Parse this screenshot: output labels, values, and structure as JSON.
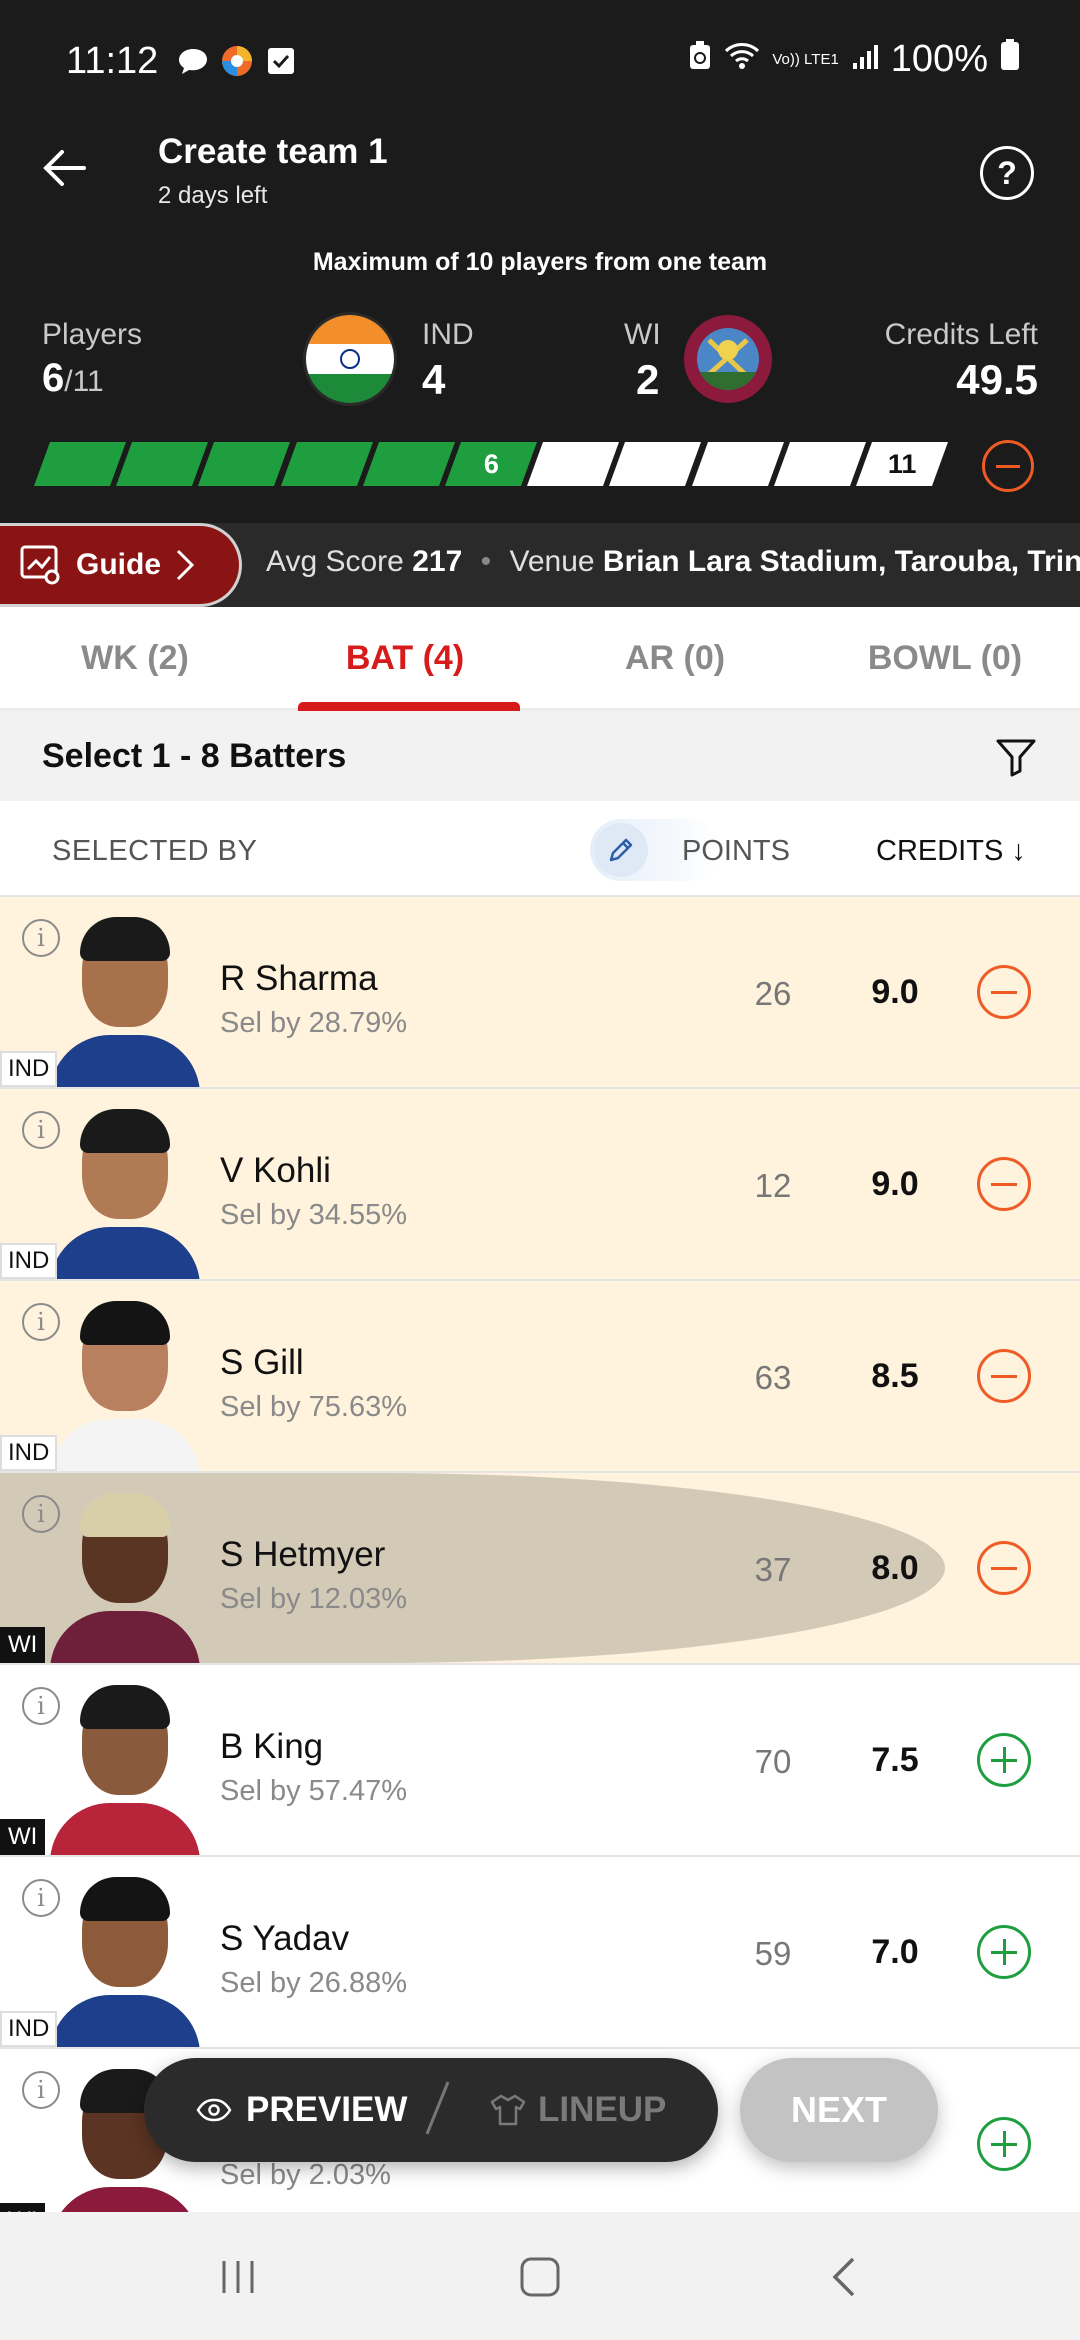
{
  "status_bar": {
    "time": "11:12",
    "icons_left": [
      "chat-icon",
      "browser-icon",
      "checkbox-icon"
    ],
    "icons_right": [
      "battery-saver-icon",
      "wifi-icon",
      "volte-icon",
      "signal-icon"
    ],
    "volte": "Vo)) LTE1",
    "battery": "100%"
  },
  "header": {
    "title": "Create team 1",
    "subtitle": "2 days left",
    "note": "Maximum of 10 players from one team"
  },
  "summary": {
    "players_label": "Players",
    "players_selected": "6",
    "players_total": "/11",
    "team1": {
      "name": "IND",
      "count": "4"
    },
    "team2": {
      "name": "WI",
      "count": "2"
    },
    "credits_label": "Credits Left",
    "credits_value": "49.5"
  },
  "progress": {
    "filled": 6,
    "total": 11,
    "filled_label": "6",
    "total_label": "11",
    "fill_color": "#1e9e3e"
  },
  "guide": {
    "label": "Guide",
    "avg_label": "Avg Score",
    "avg_value": "217",
    "venue_label": "Venue",
    "venue_value": "Brian Lara Stadium, Tarouba, Trin"
  },
  "tabs": [
    {
      "label": "WK (2)",
      "active": false
    },
    {
      "label": "BAT (4)",
      "active": true
    },
    {
      "label": "AR (0)",
      "active": false
    },
    {
      "label": "BOWL (0)",
      "active": false
    }
  ],
  "select_text": "Select 1 - 8 Batters",
  "columns": {
    "selected_by": "SELECTED BY",
    "points": "POINTS",
    "credits": "CREDITS ↓"
  },
  "players": [
    {
      "name": "R Sharma",
      "sel": "Sel by 28.79%",
      "points": "26",
      "credits": "9.0",
      "team": "IND",
      "selected": true,
      "highlight": false,
      "skin": "#a7714c",
      "hair": "#1a1a1a",
      "jersey": "#1d3f8c",
      "action": "remove"
    },
    {
      "name": "V Kohli",
      "sel": "Sel by 34.55%",
      "points": "12",
      "credits": "9.0",
      "team": "IND",
      "selected": true,
      "highlight": false,
      "skin": "#b07a55",
      "hair": "#1a1a1a",
      "jersey": "#1d3f8c",
      "action": "remove"
    },
    {
      "name": "S Gill",
      "sel": "Sel by 75.63%",
      "points": "63",
      "credits": "8.5",
      "team": "IND",
      "selected": true,
      "highlight": false,
      "skin": "#b98060",
      "hair": "#141414",
      "jersey": "#f4f4f4",
      "action": "remove"
    },
    {
      "name": "S Hetmyer",
      "sel": "Sel by 12.03%",
      "points": "37",
      "credits": "8.0",
      "team": "WI",
      "selected": true,
      "highlight": true,
      "skin": "#5a3524",
      "hair": "#d8cfa8",
      "jersey": "#6e1f3a",
      "action": "remove"
    },
    {
      "name": "B King",
      "sel": "Sel by 57.47%",
      "points": "70",
      "credits": "7.5",
      "team": "WI",
      "selected": false,
      "highlight": false,
      "skin": "#8a5a3c",
      "hair": "#1a1a1a",
      "jersey": "#b8243a",
      "action": "add"
    },
    {
      "name": "S Yadav",
      "sel": "Sel by 26.88%",
      "points": "59",
      "credits": "7.0",
      "team": "IND",
      "selected": false,
      "highlight": false,
      "skin": "#8d5b3a",
      "hair": "#141414",
      "jersey": "#1d3f8c",
      "action": "add"
    },
    {
      "name": "",
      "sel": "Sel by 2.03%",
      "points": "",
      "credits": "",
      "team": "WI",
      "selected": false,
      "highlight": false,
      "skin": "#5c3423",
      "hair": "#1a1a1a",
      "jersey": "#8b1a3c",
      "action": "add"
    }
  ],
  "bottom": {
    "preview": "PREVIEW",
    "lineup": "LINEUP",
    "next": "NEXT"
  },
  "colors": {
    "accent_red": "#d71a1a",
    "remove_orange": "#ef5b25",
    "add_green": "#1e9e3e",
    "selected_row": "#fff3dd"
  }
}
